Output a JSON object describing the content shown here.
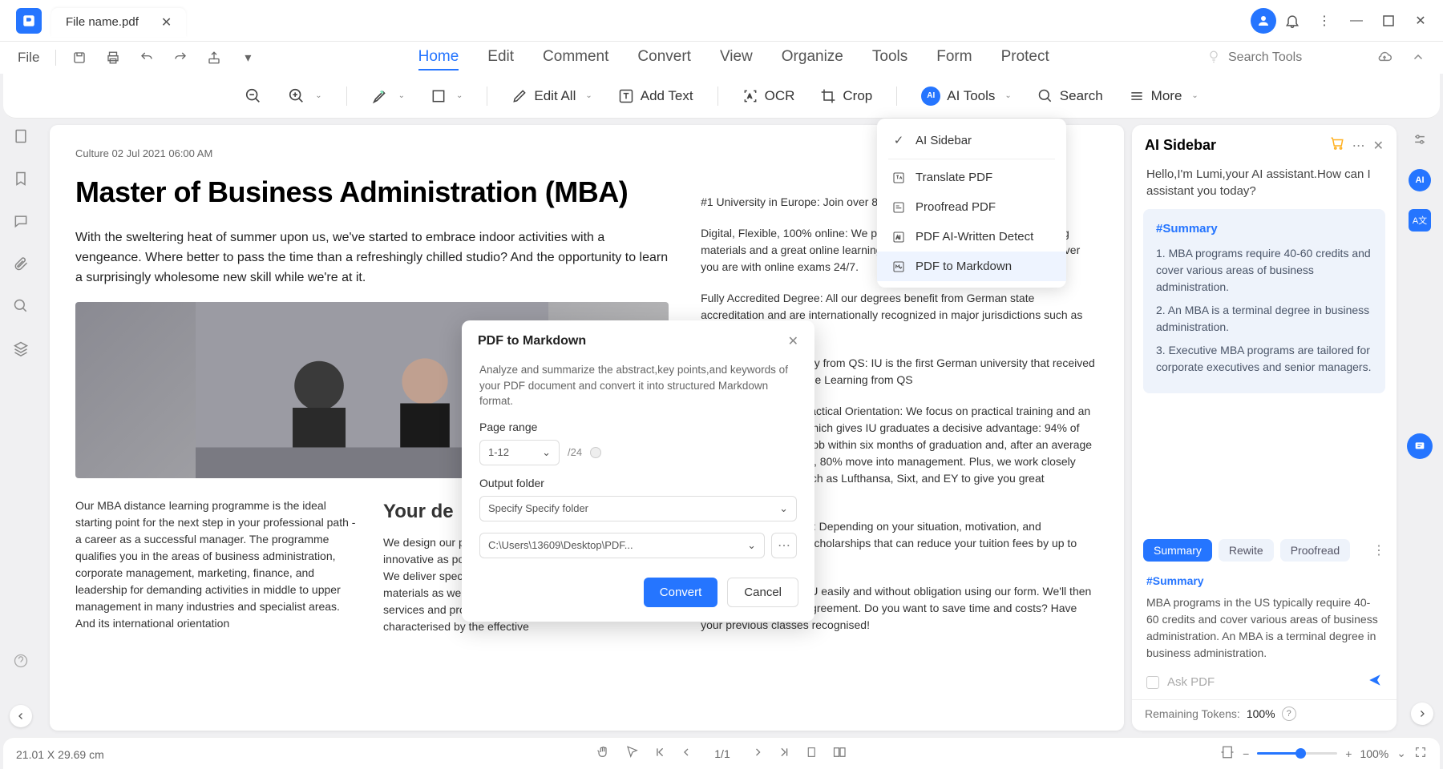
{
  "titlebar": {
    "tab_name": "File name.pdf"
  },
  "menubar": {
    "file": "File",
    "nav": [
      "Home",
      "Edit",
      "Comment",
      "Convert",
      "View",
      "Organize",
      "Tools",
      "Form",
      "Protect"
    ],
    "active_nav": 0,
    "search_placeholder": "Search Tools"
  },
  "toolbar": {
    "edit_all": "Edit All",
    "add_text": "Add Text",
    "ocr": "OCR",
    "crop": "Crop",
    "ai_tools": "AI Tools",
    "search": "Search",
    "more": "More"
  },
  "ai_dropdown": {
    "items": [
      {
        "label": "AI Sidebar",
        "icon": "check"
      },
      {
        "label": "Translate PDF",
        "icon": "translate"
      },
      {
        "label": "Proofread PDF",
        "icon": "proof"
      },
      {
        "label": "PDF AI-Written Detect",
        "icon": "detect"
      },
      {
        "label": "PDF to Markdown",
        "icon": "markdown",
        "selected": true
      }
    ]
  },
  "dialog": {
    "title": "PDF to Markdown",
    "desc": "Analyze and summarize the abstract,key points,and keywords of your PDF document and convert it into structured Markdown format.",
    "page_range_label": "Page range",
    "page_range_value": "1-12",
    "page_total": "/24",
    "output_folder_label": "Output folder",
    "output_folder_mode": "Specify Specify folder",
    "output_path": "C:\\Users\\13609\\Desktop\\PDF...",
    "convert": "Convert",
    "cancel": "Cancel"
  },
  "doc": {
    "meta": "Culture 02 Jul 2021 06:00 AM",
    "title": "Master of Business Administration (MBA)",
    "intro": "With the sweltering heat of summer upon us, we've started to embrace indoor activities with a vengeance. Where better to pass the time than a refreshingly chilled studio? And the opportunity to learn a surprisingly wholesome new skill while we're at it.",
    "sub_left": "Our MBA distance learning programme is the ideal starting point for the next step in your professional path - a career as a successful manager. The programme qualifies you in the areas of business administration, corporate management, marketing, finance, and leadership for demanding activities in middle to upper management in many industries and specialist areas. And its international orientation",
    "sub_title": "Your de",
    "sub_right": "We design our programmes to be as flexible and innovative as possible - without compromising on quality. We deliver specialist expertise and innovative learning materials as well as focusing on excellent student services and professional advice. Our programmes are characterised by the effective",
    "right_paras": [
      "#1 University in Europe: Join over 85,000 students",
      "Digital, Flexible, 100% online: We provide outstanding, interactive learning materials and a great online learning experience, so you can study wherever you are with online exams 24/7.",
      "Fully Accredited Degree: All our degrees benefit from German state accreditation and are internationally recognized in major jurisdictions such as the EU, US and",
      "A 5 star rated University from QS: IU is the first German university that received a 5 star rating for Online Learning from QS",
      "International focus, Practical Orientation: We focus on practical training and an international outlook which gives IU graduates a decisive advantage: 94% of our graduates have a job within six months of graduation and, after an average of two years on the job, 80% move into management. Plus, we work closely with big companies such as Lufthansa, Sixt, and EY to give you great opportunities and",
      "Scholarships Available: Depending on your situation, motivation, and background, we offer scholarships that can reduce your tuition fees by up to 80%.",
      "Secure your place at IU easily and without obligation using our form. We'll then send you your study agreement. Do you want to save time and costs? Have your previous classes recognised!"
    ]
  },
  "ai_sidebar": {
    "title": "AI Sidebar",
    "greeting": "Hello,I'm Lumi,your AI assistant.How can I assistant you today?",
    "summary_hash": "#Summary",
    "summary": [
      "1. MBA programs require 40-60 credits and cover various areas of business administration.",
      "2. An MBA is a terminal degree in business administration.",
      "3. Executive MBA programs are tailored for corporate executives and senior managers."
    ],
    "tabs": [
      "Summary",
      "Rewite",
      "Proofread"
    ],
    "response_hash": "#Summary",
    "response": "MBA programs in the US typically require 40-60 credits and cover various areas of business administration. An MBA is a terminal degree in business administration.",
    "ask_placeholder": "Ask PDF",
    "tokens_label": "Remaining Tokens:",
    "tokens_value": "100%"
  },
  "statusbar": {
    "dimensions": "21.01 X 29.69 cm",
    "page": "1/1",
    "zoom": "100%"
  }
}
